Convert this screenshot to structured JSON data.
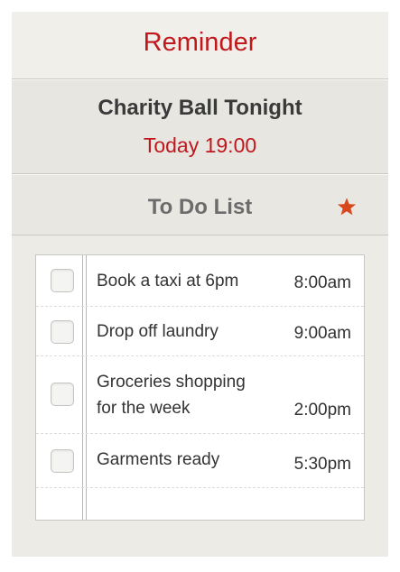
{
  "header": {
    "title": "Reminder"
  },
  "event": {
    "title": "Charity Ball Tonight",
    "time": "Today 19:00"
  },
  "todo": {
    "title": "To Do List",
    "star_icon": "star-icon",
    "items": [
      {
        "task": "Book a taxi at 6pm",
        "time": "8:00am",
        "checked": false
      },
      {
        "task": "Drop off laundry",
        "time": "9:00am",
        "checked": false
      },
      {
        "task_line1": "Groceries shopping",
        "task_line2": "for the week",
        "time": "2:00pm",
        "checked": false
      },
      {
        "task": "Garments ready",
        "time": "5:30pm",
        "checked": false
      }
    ]
  },
  "colors": {
    "accent": "#c1181d",
    "star": "#d9481c"
  }
}
